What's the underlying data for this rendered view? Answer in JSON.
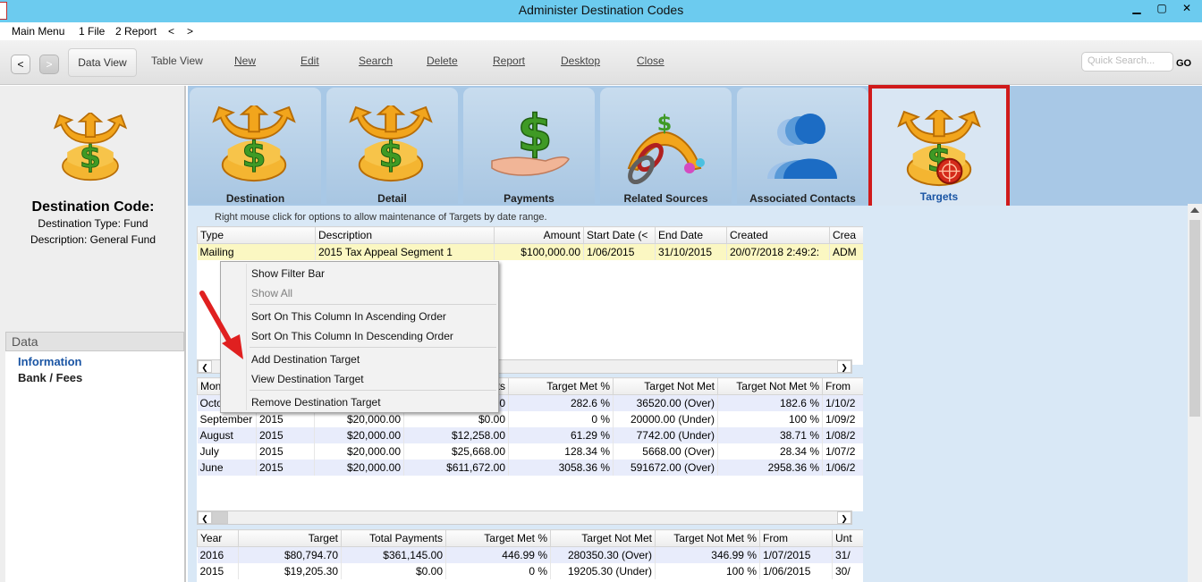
{
  "window": {
    "title": "Administer Destination Codes",
    "minimize": "▁",
    "restore": "▢",
    "close": "✕"
  },
  "menu": {
    "items": [
      "Main Menu",
      "1 File",
      "2 Report",
      "<",
      ">"
    ]
  },
  "toolbar": {
    "back": "<",
    "forward": ">",
    "data_view": "Data View",
    "table_view": "Table View",
    "new": "New",
    "edit": "Edit",
    "search": "Search",
    "delete": "Delete",
    "report": "Report",
    "desktop": "Desktop",
    "close": "Close",
    "quick_search_placeholder": "Quick Search...",
    "go": "GO"
  },
  "left": {
    "title": "Destination Code:",
    "type_line": "Destination Type: Fund",
    "desc_line": "Description: General Fund",
    "data_header": "Data",
    "items": [
      "Information",
      "Bank / Fees"
    ],
    "active_color": "#1a55a4"
  },
  "tabs": [
    {
      "label": "Destination",
      "icon": "destination-icon"
    },
    {
      "label": "Detail",
      "icon": "destination-icon"
    },
    {
      "label": "Payments",
      "icon": "payment-hand-icon"
    },
    {
      "label": "Related Sources",
      "icon": "related-sources-icon"
    },
    {
      "label": "Associated Contacts",
      "icon": "contacts-icon"
    },
    {
      "label": "Targets",
      "icon": "target-icon",
      "active": true
    }
  ],
  "hint": "Right mouse click for options to allow maintenance of Targets by date range.",
  "targets_grid": {
    "headers": [
      "Type",
      "Description",
      "Amount",
      "Start Date (<",
      "End Date",
      "Created",
      "Crea"
    ],
    "rows": [
      [
        "Mailing",
        "2015 Tax Appeal Segment 1",
        "$100,000.00",
        "1/06/2015",
        "31/10/2015",
        "20/07/2018 2:49:2:",
        "ADM"
      ]
    ]
  },
  "monthly_grid": {
    "headers": [
      "Mon",
      "",
      "",
      "ts",
      "Target Met %",
      "Target Not Met",
      "Target Not Met %",
      "From"
    ],
    "rows": [
      [
        "Octo",
        "",
        "",
        "0",
        "282.6 %",
        "36520.00 (Over)",
        "182.6 %",
        "1/10/2"
      ],
      [
        "September",
        "2015",
        "$20,000.00",
        "$0.00",
        "0 %",
        "20000.00 (Under)",
        "100 %",
        "1/09/2"
      ],
      [
        "August",
        "2015",
        "$20,000.00",
        "$12,258.00",
        "61.29 %",
        "7742.00 (Under)",
        "38.71 %",
        "1/08/2"
      ],
      [
        "July",
        "2015",
        "$20,000.00",
        "$25,668.00",
        "128.34 %",
        "5668.00 (Over)",
        "28.34 %",
        "1/07/2"
      ],
      [
        "June",
        "2015",
        "$20,000.00",
        "$611,672.00",
        "3058.36 %",
        "591672.00 (Over)",
        "2958.36 %",
        "1/06/2"
      ]
    ]
  },
  "yearly_grid": {
    "headers": [
      "Year",
      "Target",
      "Total Payments",
      "Target Met %",
      "Target Not Met",
      "Target Not Met %",
      "From",
      "Unt"
    ],
    "rows": [
      [
        "2016",
        "$80,794.70",
        "$361,145.00",
        "446.99 %",
        "280350.30 (Over)",
        "346.99 %",
        "1/07/2015",
        "31/"
      ],
      [
        "2015",
        "$19,205.30",
        "$0.00",
        "0 %",
        "19205.30 (Under)",
        "100 %",
        "1/06/2015",
        "30/"
      ]
    ]
  },
  "context_menu": {
    "show_filter_bar": "Show Filter Bar",
    "show_all": "Show All",
    "sort_asc": "Sort On This Column In Ascending Order",
    "sort_desc": "Sort On This Column In Descending Order",
    "add_target": "Add Destination Target",
    "view_target": "View Destination Target",
    "remove_target": "Remove Destination Target"
  },
  "scroll": {
    "left": "❮",
    "right": "❯"
  },
  "colors": {
    "titlebar": "#6ccbef",
    "tab_bg": "#a8c8e6",
    "highlight_box": "#d01a1a",
    "selected_row": "#fbf7c2",
    "alt_row": "#e8ecfb",
    "arrow": "#e02020"
  }
}
